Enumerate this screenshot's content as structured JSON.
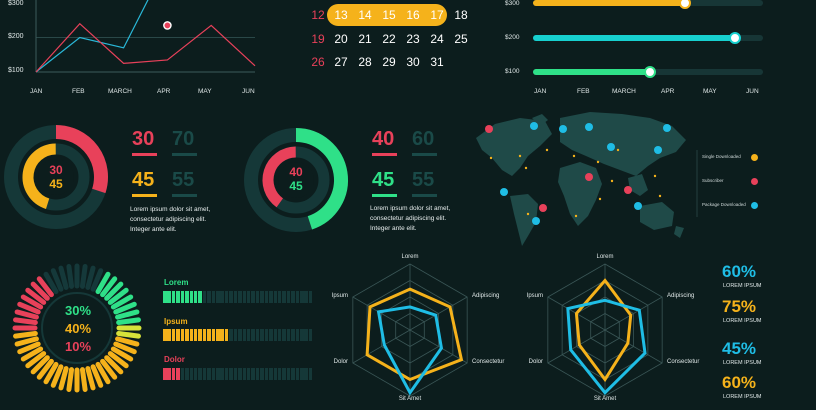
{
  "colors": {
    "bg": "#0c1d1d",
    "teal": "#1a4040",
    "red": "#e8415a",
    "yellow": "#f5b21b",
    "green": "#2fe088",
    "cyan": "#1fbde5",
    "cyanbar": "#17d0cf"
  },
  "chart_data": [
    {
      "type": "line",
      "categories": [
        "JAN",
        "FEB",
        "MARCH",
        "APR",
        "MAY",
        "JUN"
      ],
      "ytick_labels": [
        "$100",
        "$200",
        "$300"
      ],
      "series": [
        {
          "color": "#2ab8d8",
          "values": [
            100,
            200,
            170,
            420,
            null,
            null
          ]
        },
        {
          "color": "#e8415a",
          "values": [
            100,
            240,
            125,
            135,
            235,
            118
          ]
        }
      ],
      "marker": {
        "category": "APR",
        "value": 235
      }
    },
    {
      "type": "bar",
      "orientation": "horizontal",
      "categories": [
        "JAN",
        "FEB",
        "MARCH",
        "APR",
        "MAY",
        "JUN"
      ],
      "ytick_labels": [
        "$300",
        "$200",
        "$100"
      ],
      "bars": [
        {
          "label": "$300",
          "fraction": 0.66,
          "color": "#f5b21b"
        },
        {
          "label": "$200",
          "fraction": 0.88,
          "color": "#17d0cf"
        },
        {
          "label": "$100",
          "fraction": 0.51,
          "color": "#2fe088"
        }
      ]
    },
    {
      "type": "pie",
      "style": "donut",
      "inner_value": 45,
      "outer_value": 30,
      "inner_color": "#f5b21b",
      "outer_color": "#e8415a"
    },
    {
      "type": "pie",
      "style": "donut",
      "inner_value": 40,
      "outer_value": 45,
      "inner_color": "#e8415a",
      "outer_color": "#2fe088"
    },
    {
      "type": "pie",
      "style": "segmented-ring",
      "segments": [
        {
          "value": 30,
          "color": "#2fe088"
        },
        {
          "value": 40,
          "color": "#f5b21b"
        },
        {
          "value": 10,
          "color": "#e8415a"
        }
      ]
    },
    {
      "type": "bar",
      "orientation": "horizontal",
      "style": "segmented",
      "bars": [
        {
          "label": "Lorem",
          "fraction": 0.25,
          "color": "#2fe088"
        },
        {
          "label": "Ipsum",
          "fraction": 0.45,
          "color": "#f5b21b"
        },
        {
          "label": "Dolor",
          "fraction": 0.12,
          "color": "#e8415a"
        }
      ]
    },
    {
      "type": "radar",
      "axes": [
        "Lorem",
        "Adipiscing",
        "Consectetur",
        "Sit Amet",
        "Dolor",
        "Ipsum"
      ],
      "series": [
        {
          "color": "#f5b21b",
          "values": [
            0.62,
            0.7,
            0.9,
            0.75,
            0.75,
            0.7
          ]
        },
        {
          "color": "#1fbde5",
          "values": [
            0.35,
            0.45,
            0.55,
            0.95,
            0.45,
            0.55
          ]
        }
      ]
    },
    {
      "type": "radar",
      "axes": [
        "Lorem",
        "Adipiscing",
        "Consectetur",
        "Sit Amet",
        "Dolor",
        "Ipsum"
      ],
      "series": [
        {
          "color": "#f5b21b",
          "values": [
            0.75,
            0.45,
            0.4,
            0.75,
            0.45,
            0.5
          ]
        },
        {
          "color": "#1fbde5",
          "values": [
            0.45,
            0.6,
            0.7,
            0.95,
            0.6,
            0.65
          ]
        }
      ]
    }
  ],
  "calendar": {
    "rows": [
      [
        "12",
        "13",
        "14",
        "15",
        "16",
        "17",
        "18"
      ],
      [
        "19",
        "20",
        "21",
        "22",
        "23",
        "24",
        "25"
      ],
      [
        "26",
        "27",
        "28",
        "29",
        "30",
        "31"
      ]
    ],
    "highlighted": [
      "13",
      "14",
      "15",
      "16",
      "17"
    ]
  },
  "donut1": {
    "inner_top": "30",
    "inner_bottom": "45",
    "stats": [
      {
        "value": "30",
        "color": "#e8415a"
      },
      {
        "value": "70",
        "color": "#1a4a48"
      },
      {
        "value": "45",
        "color": "#f5b21b"
      },
      {
        "value": "55",
        "color": "#1a4a48"
      }
    ],
    "text": [
      "Lorem ipsum dolor sit amet,",
      "consectetur adipiscing elit.",
      "Integer ante elit."
    ]
  },
  "donut2": {
    "inner_top": "40",
    "inner_bottom": "45",
    "stats": [
      {
        "value": "40",
        "color": "#e8415a"
      },
      {
        "value": "60",
        "color": "#1a4a48"
      },
      {
        "value": "45",
        "color": "#2fe088"
      },
      {
        "value": "55",
        "color": "#1a4a48"
      }
    ],
    "text": [
      "Lorem ipsum dolor sit amet,",
      "consectetur adipiscing elit.",
      "Integer ante elit."
    ]
  },
  "map_legend": [
    {
      "label": "Single Downloaded",
      "color": "#f5b21b"
    },
    {
      "label": "Subscriber",
      "color": "#e8415a"
    },
    {
      "label": "Package Downloaded",
      "color": "#1fbde5"
    }
  ],
  "ring_labels": [
    "30%",
    "40%",
    "10%"
  ],
  "percent_list": [
    {
      "value": "60%",
      "label": "LOREM IPSUM",
      "color": "#1fbde5"
    },
    {
      "value": "75%",
      "label": "LOREM IPSUM",
      "color": "#f5b21b"
    },
    {
      "value": "45%",
      "label": "LOREM IPSUM",
      "color": "#1fbde5"
    },
    {
      "value": "60%",
      "label": "LOREM IPSUM",
      "color": "#f5b21b"
    }
  ]
}
